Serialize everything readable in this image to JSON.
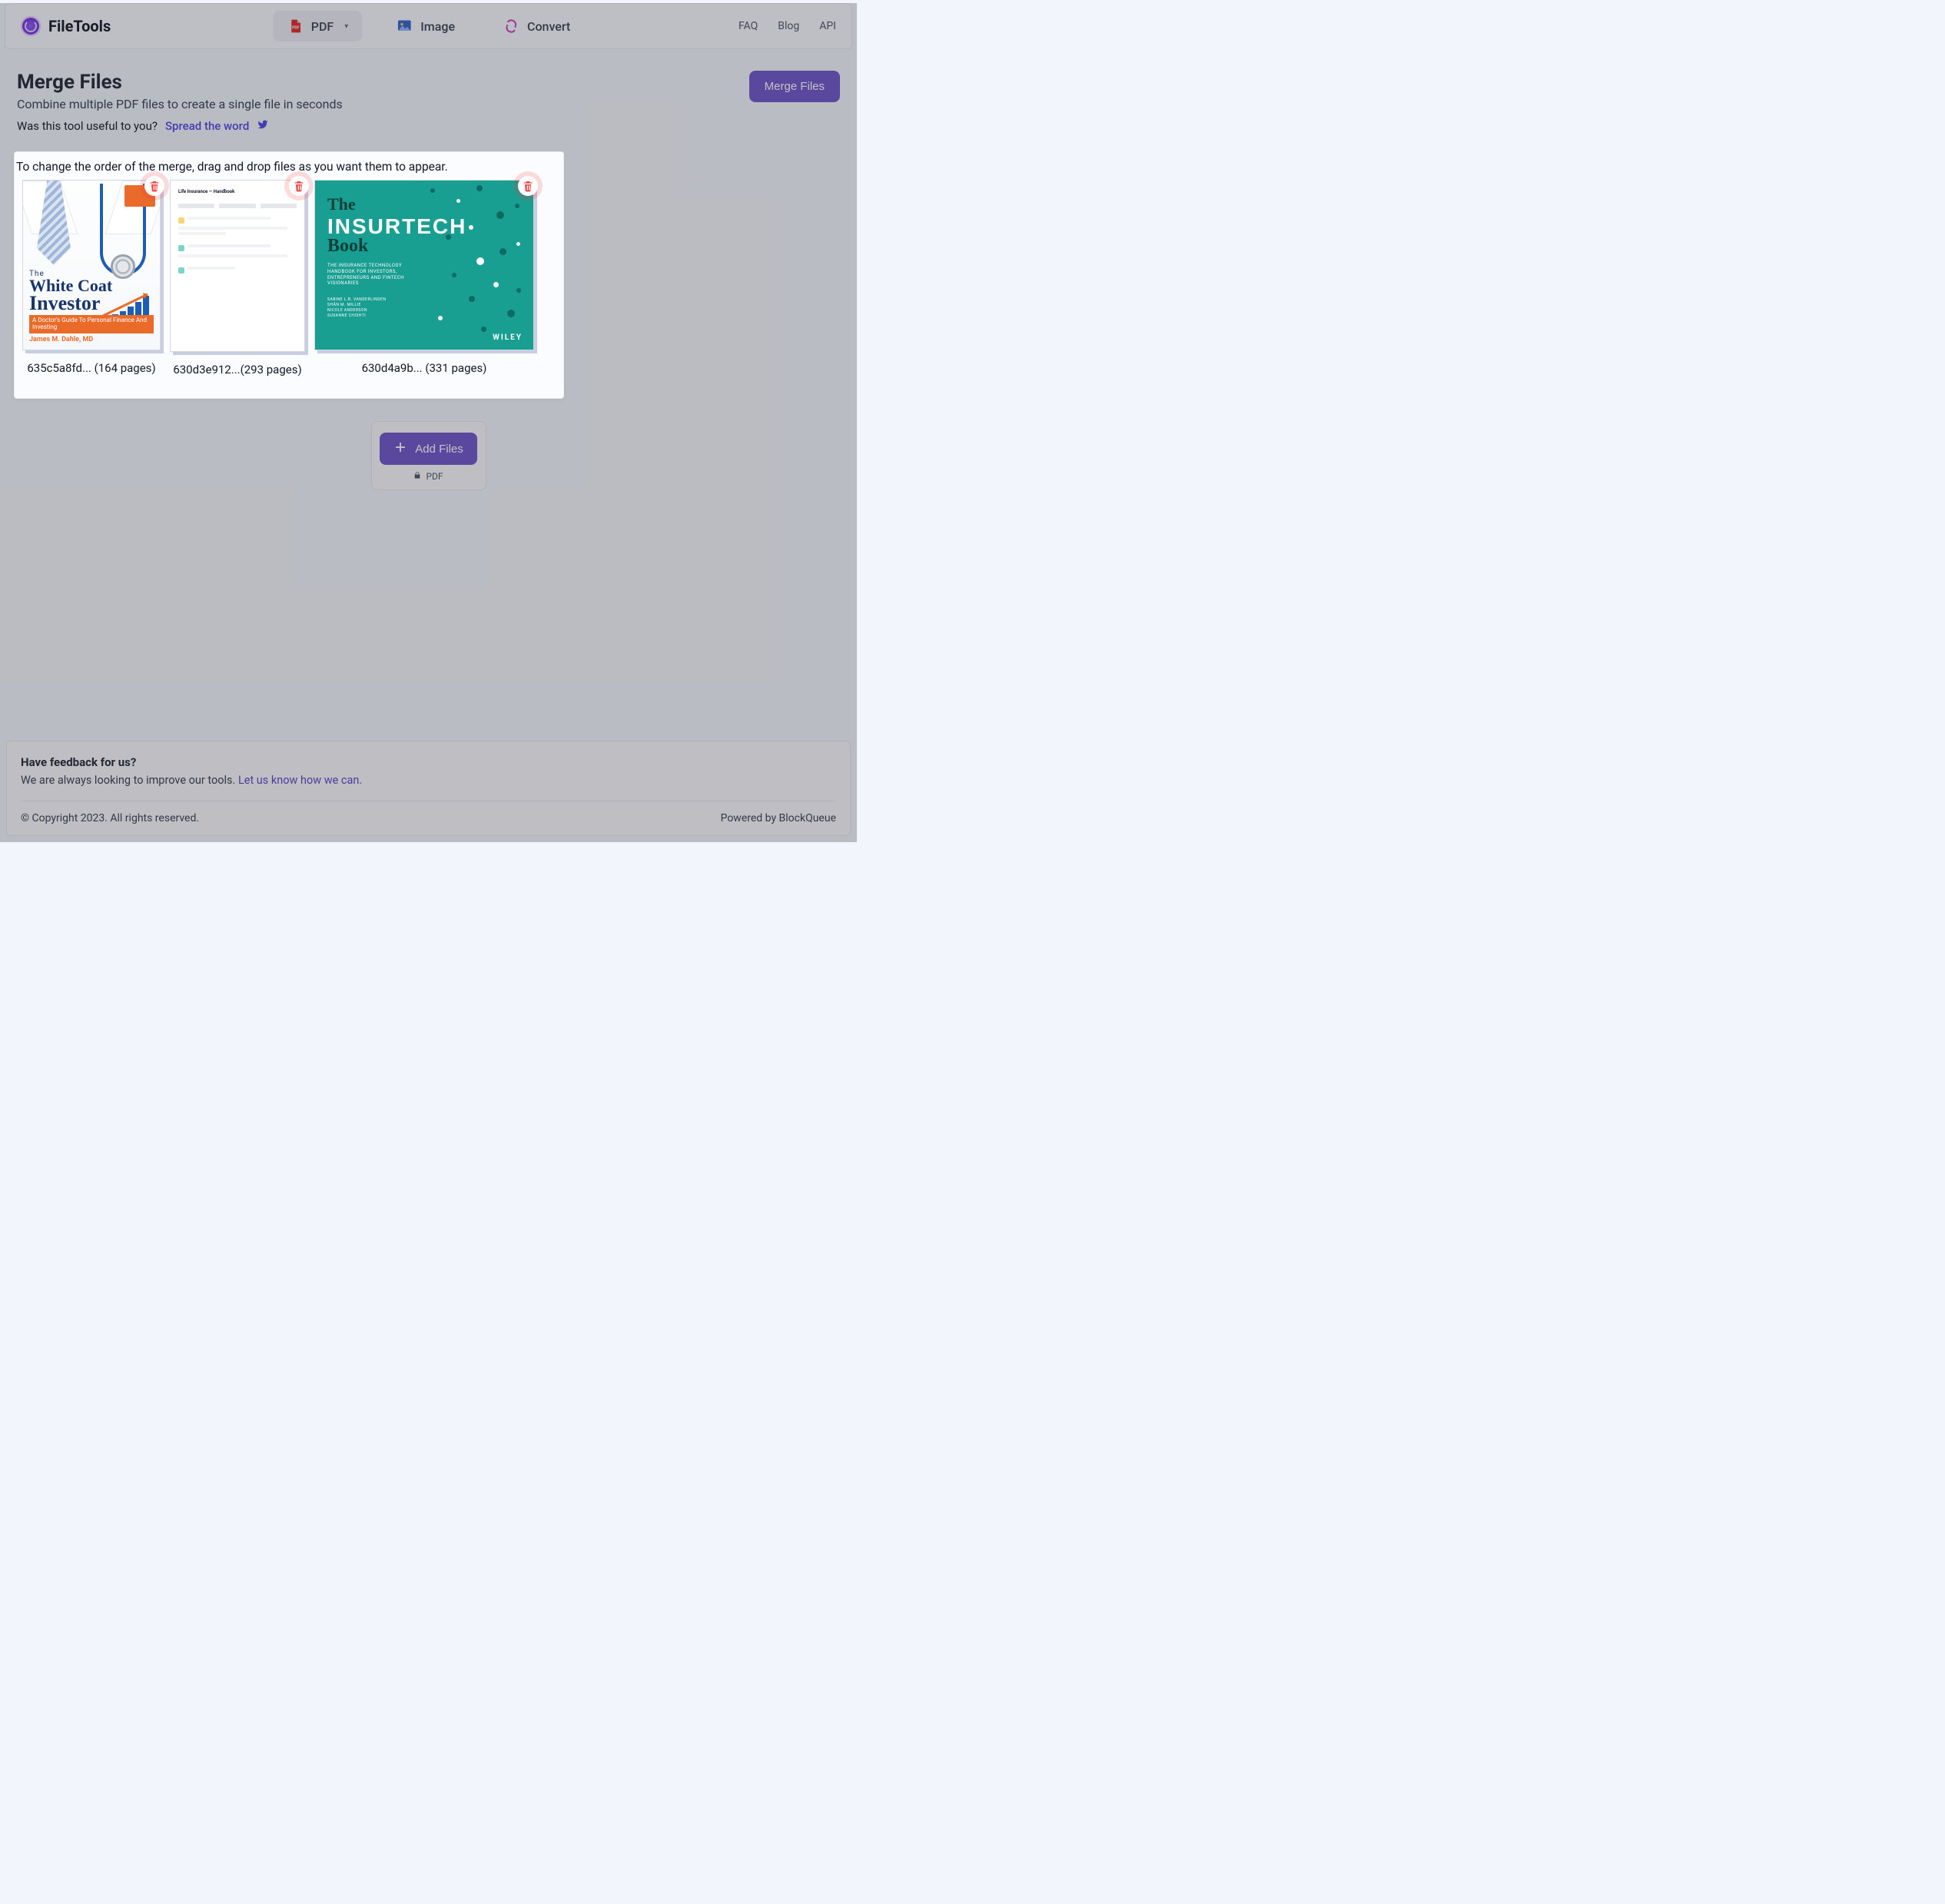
{
  "brand": {
    "name": "FileTools"
  },
  "nav": {
    "items": [
      {
        "label": "PDF",
        "active": true
      },
      {
        "label": "Image",
        "active": false
      },
      {
        "label": "Convert",
        "active": false
      }
    ],
    "right": [
      {
        "label": "FAQ"
      },
      {
        "label": "Blog"
      },
      {
        "label": "API"
      }
    ]
  },
  "page": {
    "title": "Merge Files",
    "subtitle": "Combine multiple PDF files to create a single file in seconds",
    "useful_prompt": "Was this tool useful to you?",
    "spread_label": "Spread the word",
    "merge_button": "Merge Files"
  },
  "panel": {
    "instruction": "To change the order of the merge, drag and drop files as you want them to appear.",
    "files": [
      {
        "id_short": "635c5a8fd...",
        "pages": 164,
        "label": "635c5a8fd... (164 pages)",
        "cover": {
          "pretitle": "The",
          "title_line1": "White Coat",
          "title_line2": "Investor",
          "tagline": "A Doctor's Guide To Personal Finance And Investing",
          "author": "James M. Dahle, MD"
        }
      },
      {
        "id_short": "630d3e912...",
        "pages": 293,
        "label": "630d3e912...(293 pages)",
        "doc_heading": "Life Insurance — Handbook"
      },
      {
        "id_short": "630d4a9b...",
        "pages": 331,
        "label": "630d4a9b...  (331 pages)",
        "cover": {
          "line1": "The",
          "line2": "INSURTECH",
          "line3": "Book",
          "subtitle": "THE INSURANCE TECHNOLOGY HANDBOOK FOR INVESTORS, ENTREPRENEURS AND FINTECH VISIONARIES",
          "authors": "SABINE L.B. VANDERLINDEN\nSHÂN M. MILLIE\nNICOLE ANDERSON\nSUSANNE CHISHTI",
          "publisher": "WILEY"
        }
      }
    ]
  },
  "add": {
    "button": "Add Files",
    "hint": "PDF"
  },
  "footer": {
    "feedback_title": "Have feedback for us?",
    "feedback_text": "We are always looking to improve our tools. ",
    "feedback_link": "Let us know how we can.",
    "copyright": "© Copyright 2023. All rights reserved.",
    "powered": "Powered by BlockQueue"
  }
}
